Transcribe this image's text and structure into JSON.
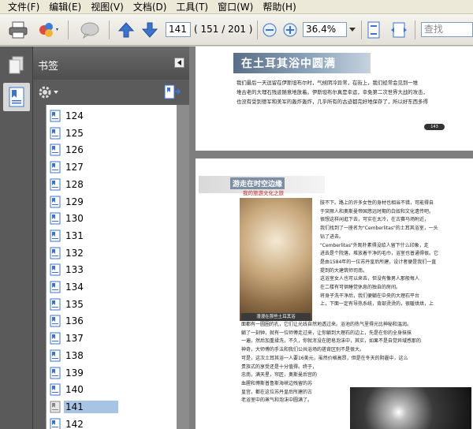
{
  "menu": [
    "文件(F)",
    "编辑(E)",
    "视图(V)",
    "文档(D)",
    "工具(T)",
    "窗口(W)",
    "帮助(H)"
  ],
  "toolbar": {
    "current_page": "141",
    "page_count": "( 151 / 201 )",
    "zoom": "36.4%",
    "search_placeholder": "查找"
  },
  "bookmarks": {
    "title": "书签",
    "selected": "141",
    "items": [
      "124",
      "125",
      "126",
      "127",
      "128",
      "129",
      "130",
      "131",
      "132",
      "133",
      "134",
      "135",
      "136",
      "137",
      "138",
      "139",
      "140",
      "141",
      "142"
    ]
  },
  "doc": {
    "page1_title": "在土耳其浴中圆满",
    "page1_lines": [
      "我们最后一天逗留在伊斯坦布尔时，气候阴冷异常，在街上，我们经常会见到一堆",
      "堆古老的大理石残迹随意地放着。伊斯坦布尔真是幸运，幸免第二次世界大战的攻击，",
      "也没有受到德军和美军的轰炸轰炸，几乎所有的古迹都完好地保存了，所以好东西多得"
    ],
    "page2_title": "游走在时空边缘",
    "page2_subtitle": "我的旅游文化之旅",
    "page2_photo_caption": "漫漫在那些土耳其浴",
    "page2_right_lines": [
      "肢不下。路上的许多女性的身材也相当不错，可能得自",
      "于突厥人和奥斯曼帝国悠远时期的白奴和文化遗传吧。",
      "很想这样闲逛下去，可实在太冷，在古赛马场附近，",
      "我们找到了一座名为\"Cemberlitas\"的土耳其浴室，一头",
      "钻了进去。",
      "\"Cemberlitas\"外观朴素得没给人留下什么印象，走",
      "进去是个院落，堆放着干净的毛巾，浴室也普通得很。它",
      "是由1584年的一位苏丹皇后所建，设计者便是我们一直",
      "提到的大建筑师司南。",
      "这浴室女人也可以来去，但没有像男人那般每人",
      "在二楼有可供睡觉休息的独自的房间。",
      "将身子洗干净后，我们便躺在中央的大理石平台",
      "上，下面一定有导热系统，背部烫烫的，很暖烘烘，上"
    ],
    "page2_bottom_lines": [
      "面都有一圆圈的孔，它们让光线自然地透过来。浴池的热气里得光比神秘和温润。",
      "躺了一刻钟，就有一位师傅走过来，让你躺到大理石的边上，先是在你的全身抹抹",
      "一遍，然后加重揉洗，不久，你就浑没在肥皂泡沫中，其实，如果不是自觉异域感那的",
      "神奇，大师傅的手法和我们公共浴场的搓背区别不是很大。",
      "可是，这次土耳其浴一人要16美元，虽然价格高昂，但是在冬天的阴霾中，这么",
      "贵族式的享受还是十分值得。终于，",
      "忠南，满天星，帘匠，奥斯曼后宫的",
      "血腥和博斯普鲁斯海峡边残留的苏",
      "皇宫，都在这位苏丹皇后所建的古",
      "老浴室中的蒸气和泡沫中圆满了。"
    ],
    "page1_number": "143"
  }
}
